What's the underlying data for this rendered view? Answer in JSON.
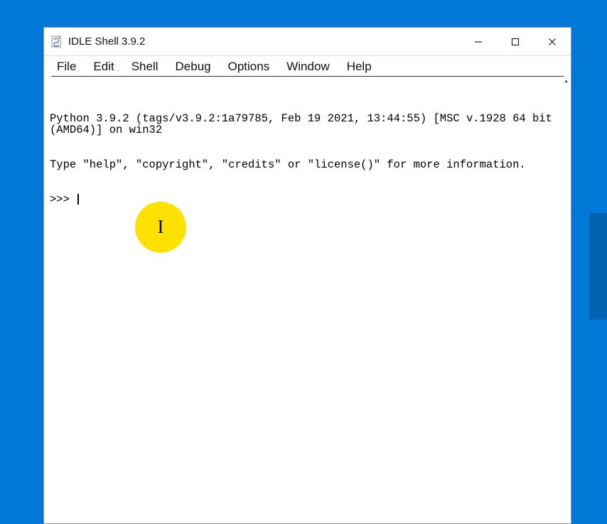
{
  "window": {
    "title": "IDLE Shell 3.9.2"
  },
  "menu": {
    "file": "File",
    "edit": "Edit",
    "shell": "Shell",
    "debug": "Debug",
    "options": "Options",
    "window": "Window",
    "help": "Help"
  },
  "terminal": {
    "line1": "Python 3.9.2 (tags/v3.9.2:1a79785, Feb 19 2021, 13:44:55) [MSC v.1928 64 bit (AMD64)] on win32",
    "line2": "Type \"help\", \"copyright\", \"credits\" or \"license()\" for more information.",
    "prompt": ">>> "
  },
  "cursor_marker": "I"
}
